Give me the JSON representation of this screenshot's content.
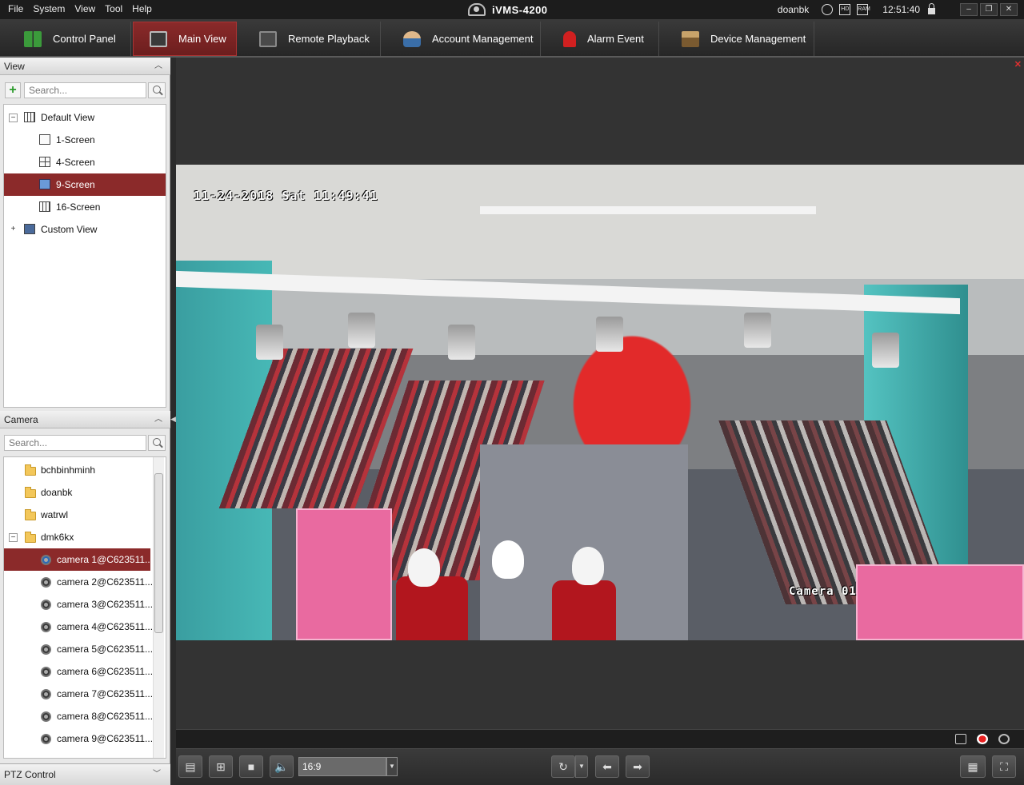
{
  "menu": [
    "File",
    "System",
    "View",
    "Tool",
    "Help"
  ],
  "app_title": "iVMS-4200",
  "status": {
    "user": "doanbk",
    "time": "12:51:40",
    "hd_badge": "HD",
    "ram_badge": "RAM"
  },
  "nav_tabs": [
    {
      "label": "Control Panel"
    },
    {
      "label": "Main View"
    },
    {
      "label": "Remote Playback"
    },
    {
      "label": "Account Management"
    },
    {
      "label": "Alarm Event"
    },
    {
      "label": "Device Management"
    }
  ],
  "view_panel": {
    "title": "View",
    "search_placeholder": "Search...",
    "tree": [
      {
        "label": "Default View",
        "expander": "−"
      },
      {
        "label": "1-Screen"
      },
      {
        "label": "4-Screen"
      },
      {
        "label": "9-Screen"
      },
      {
        "label": "16-Screen"
      },
      {
        "label": "Custom View",
        "expander": "+"
      }
    ]
  },
  "camera_panel": {
    "title": "Camera",
    "search_placeholder": "Search...",
    "tree": [
      {
        "label": "bchbinhminh"
      },
      {
        "label": "doanbk"
      },
      {
        "label": "watrwl"
      },
      {
        "label": "dmk6kx",
        "expander": "−"
      },
      {
        "label": "camera 1@C623511..."
      },
      {
        "label": "camera 2@C623511..."
      },
      {
        "label": "camera 3@C623511..."
      },
      {
        "label": "camera 4@C623511..."
      },
      {
        "label": "camera 5@C623511..."
      },
      {
        "label": "camera 6@C623511..."
      },
      {
        "label": "camera 7@C623511..."
      },
      {
        "label": "camera 8@C623511..."
      },
      {
        "label": "camera 9@C623511..."
      }
    ]
  },
  "ptz_panel": {
    "title": "PTZ Control"
  },
  "video": {
    "osd_datetime": "11-24-2018 Sat 11:49:41",
    "osd_camera": "Camera 01"
  },
  "toolbar": {
    "aspect_ratio": "16:9"
  },
  "colors": {
    "accent": "#8b2a2a",
    "alarm": "#e03030"
  }
}
